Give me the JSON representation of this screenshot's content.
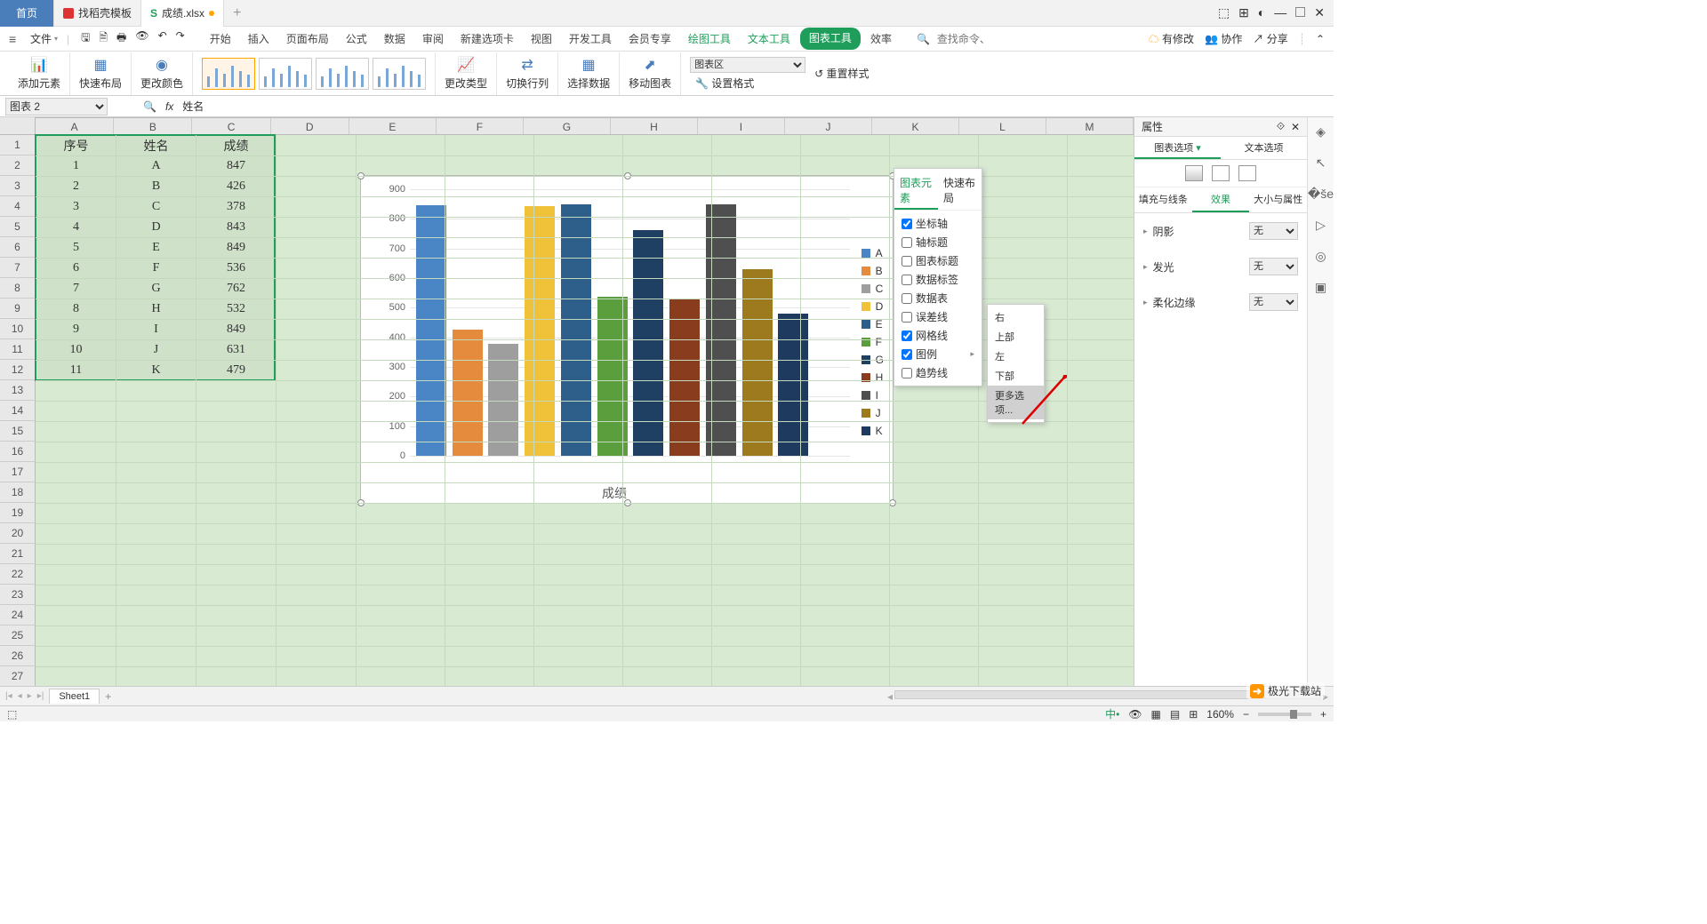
{
  "tabs": {
    "home": "首页",
    "t1": "找稻壳模板",
    "t2": "成绩.xlsx",
    "add": "+"
  },
  "menu": {
    "file": "文件"
  },
  "menutabs": {
    "m0": "开始",
    "m1": "插入",
    "m2": "页面布局",
    "m3": "公式",
    "m4": "数据",
    "m5": "审阅",
    "m6": "新建选项卡",
    "m7": "视图",
    "m8": "开发工具",
    "m9": "会员专享",
    "m10": "绘图工具",
    "m11": "文本工具",
    "m12": "图表工具",
    "m13": "效率"
  },
  "searchcmd": "查找命令、搜索模板",
  "rightmenu": {
    "cloud": "有修改",
    "coop": "协作",
    "share": "分享"
  },
  "ribbon": {
    "add": "添加元素",
    "quick": "快速布局",
    "color": "更改颜色",
    "type": "更改类型",
    "swap": "切换行列",
    "seldata": "选择数据",
    "move": "移动图表",
    "combo": "图表区",
    "fmt": "设置格式",
    "reset": "重置样式"
  },
  "namebox": "图表 2",
  "fxlabel": "fx",
  "fxval": "姓名",
  "cols": [
    "A",
    "B",
    "C",
    "D",
    "E",
    "F",
    "G",
    "H",
    "I",
    "J",
    "K",
    "L",
    "M"
  ],
  "table": {
    "header": [
      "序号",
      "姓名",
      "成绩"
    ],
    "rows": [
      [
        "1",
        "A",
        "847"
      ],
      [
        "2",
        "B",
        "426"
      ],
      [
        "3",
        "C",
        "378"
      ],
      [
        "4",
        "D",
        "843"
      ],
      [
        "5",
        "E",
        "849"
      ],
      [
        "6",
        "F",
        "536"
      ],
      [
        "7",
        "G",
        "762"
      ],
      [
        "8",
        "H",
        "532"
      ],
      [
        "9",
        "I",
        "849"
      ],
      [
        "10",
        "J",
        "631"
      ],
      [
        "11",
        "K",
        "479"
      ]
    ]
  },
  "popup1": {
    "tab1": "图表元素",
    "tab2": "快速布局",
    "items": [
      {
        "label": "坐标轴",
        "checked": true
      },
      {
        "label": "轴标题",
        "checked": false
      },
      {
        "label": "图表标题",
        "checked": false
      },
      {
        "label": "数据标签",
        "checked": false
      },
      {
        "label": "数据表",
        "checked": false
      },
      {
        "label": "误差线",
        "checked": false
      },
      {
        "label": "网格线",
        "checked": true
      },
      {
        "label": "图例",
        "checked": true,
        "arrow": true
      },
      {
        "label": "趋势线",
        "checked": false
      }
    ]
  },
  "popup2": {
    "items": [
      "右",
      "上部",
      "左",
      "下部",
      "更多选项..."
    ],
    "hover": 4
  },
  "rpanel": {
    "title": "属性",
    "tab1": "图表选项",
    "tab2": "文本选项",
    "t3a": "填充与线条",
    "t3b": "效果",
    "t3c": "大小与属性",
    "p1": "阴影",
    "p2": "发光",
    "p3": "柔化边缘",
    "none": "无"
  },
  "sheet": "Sheet1",
  "zoom": "160%",
  "chart_data": {
    "type": "bar",
    "categories": [
      "A",
      "B",
      "C",
      "D",
      "E",
      "F",
      "G",
      "H",
      "I",
      "J",
      "K"
    ],
    "values": [
      847,
      426,
      378,
      843,
      849,
      536,
      762,
      532,
      849,
      631,
      479
    ],
    "colors": [
      "#4a86c5",
      "#e58b3e",
      "#9e9e9e",
      "#f0c23a",
      "#2e5f8a",
      "#5a9e3e",
      "#1f3f63",
      "#8a3c1f",
      "#4f4f4f",
      "#9e7a1e",
      "#1f3a5f"
    ],
    "xlabel": "成绩",
    "ylim": [
      0,
      900
    ],
    "ystep": 100
  },
  "watermark": "极光下载站"
}
